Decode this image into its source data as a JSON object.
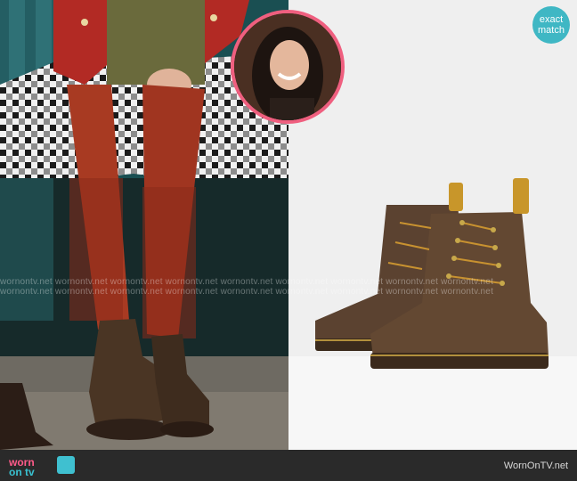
{
  "badge": {
    "line1": "exact",
    "line2": "match"
  },
  "watermark": {
    "text": "wornontv.net  wornontv.net  wornontv.net  wornontv.net  wornontv.net  wornontv.net  wornontv.net  wornontv.net  wornontv.net"
  },
  "footer": {
    "logo_line1": "worn",
    "logo_line2": "on tv",
    "site": "WornOnTV.net"
  },
  "colors": {
    "inset_border": "#ef5f7f",
    "badge": "#3fb7c4",
    "footer_bg": "#2a2a2a",
    "logo_pink": "#ff5b8a",
    "logo_teal": "#39c1d0"
  }
}
